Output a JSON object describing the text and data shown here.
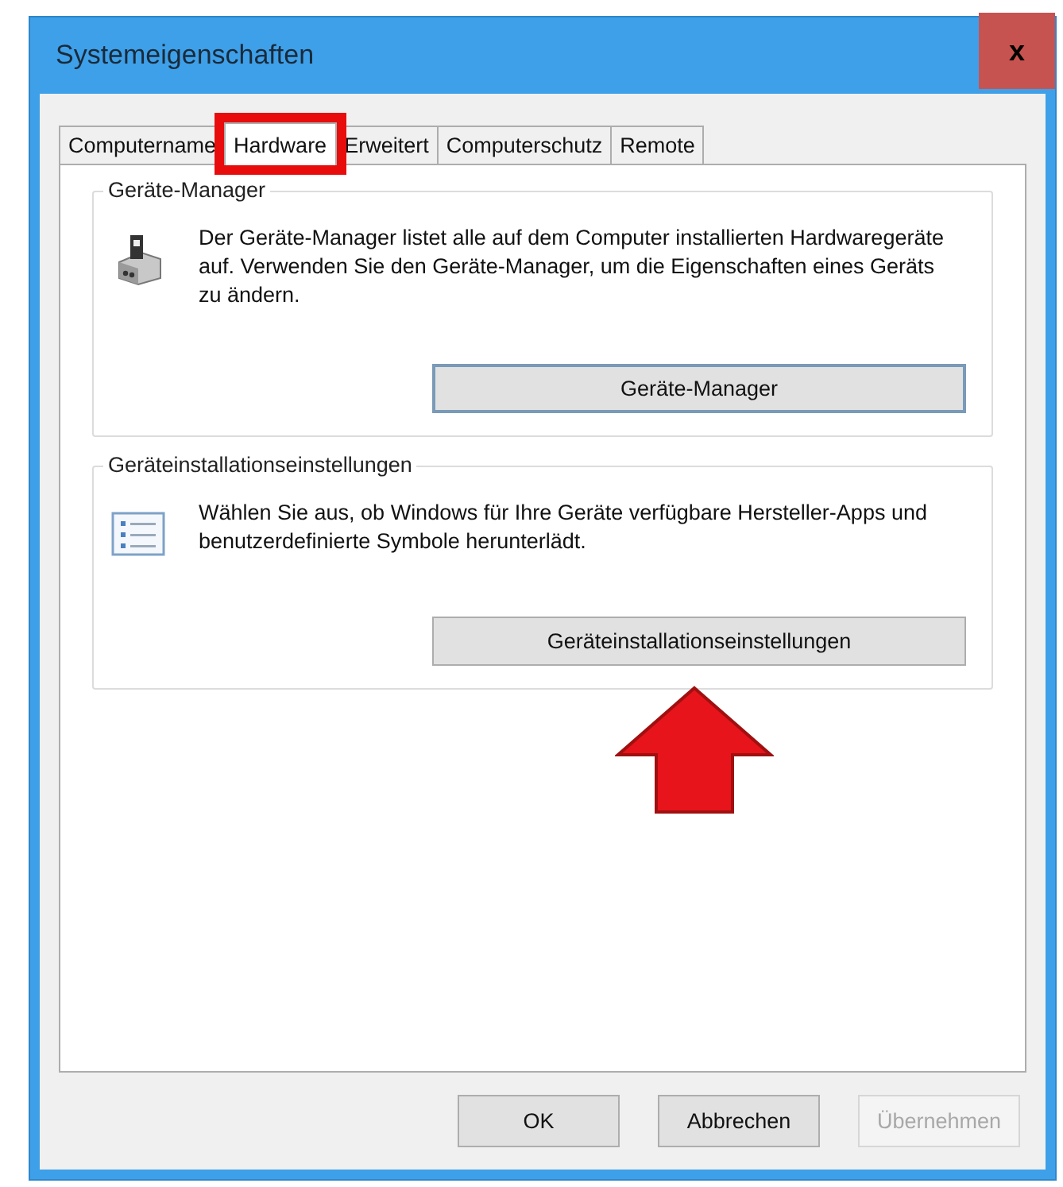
{
  "window": {
    "title": "Systemeigenschaften",
    "close": "x"
  },
  "tabs": [
    {
      "label": "Computername",
      "selected": false,
      "highlighted": false
    },
    {
      "label": "Hardware",
      "selected": true,
      "highlighted": true
    },
    {
      "label": "Erweitert",
      "selected": false,
      "highlighted": false
    },
    {
      "label": "Computerschutz",
      "selected": false,
      "highlighted": false
    },
    {
      "label": "Remote",
      "selected": false,
      "highlighted": false
    }
  ],
  "groups": [
    {
      "kind": "device-manager",
      "title": "Geräte-Manager",
      "text": "Der Geräte-Manager listet alle auf dem Computer installierten Hardwaregeräte auf. Verwenden Sie den Geräte-Manager, um die Eigenschaften eines Geräts zu ändern.",
      "button": "Geräte-Manager",
      "arrow": false
    },
    {
      "kind": "install-settings",
      "title": "Geräteinstallationseinstellungen",
      "text": "Wählen Sie aus, ob Windows für Ihre Geräte verfügbare Hersteller-Apps und benutzerdefinierte Symbole herunterlädt.",
      "button": "Geräteinstallationseinstellungen",
      "arrow": true
    }
  ],
  "buttons": [
    {
      "label": "OK",
      "disabled": false
    },
    {
      "label": "Abbrechen",
      "disabled": false
    },
    {
      "label": "Übernehmen",
      "disabled": true
    }
  ]
}
